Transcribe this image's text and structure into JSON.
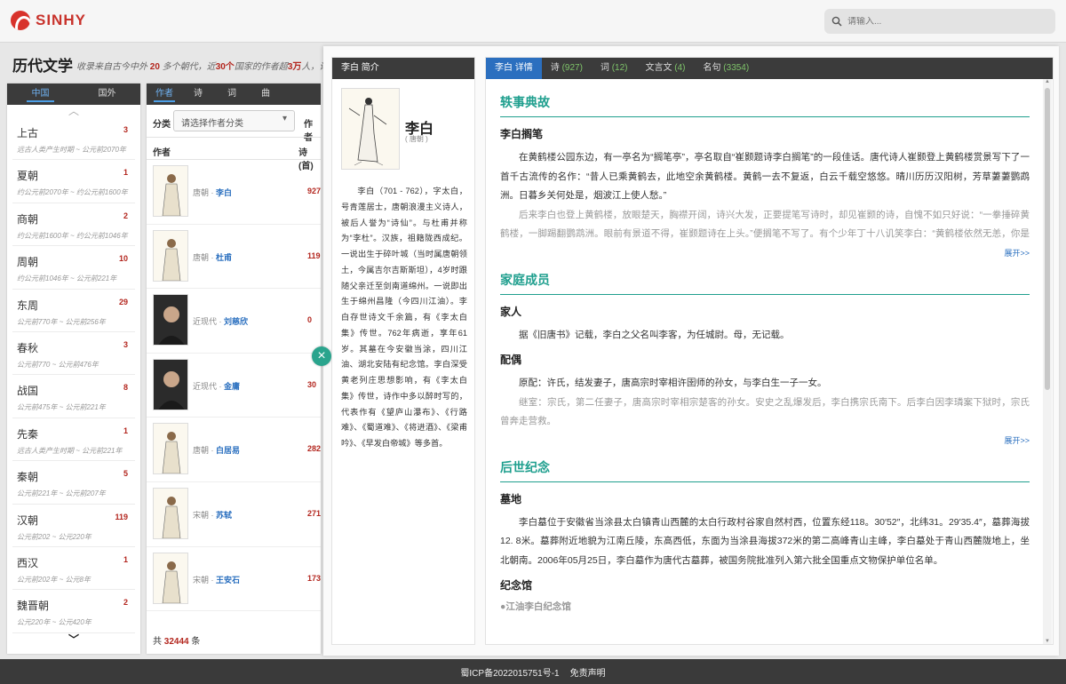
{
  "header": {
    "logo_text": "SINHY",
    "search_placeholder": "请输入..."
  },
  "page": {
    "title": "历代文学",
    "desc_prefix": "收录来自古今中外",
    "desc_n1": "20",
    "desc_mid1": "多个朝代，近",
    "desc_n2": "30个",
    "desc_mid2": "国家的作者超",
    "desc_n3": "3万",
    "desc_suffix": "人，诗、"
  },
  "dynasty_tabs": [
    "中国",
    "国外"
  ],
  "dynasties": [
    {
      "name": "上古",
      "count": "3",
      "range": "远古人类产生时期 ~ 公元前2070年"
    },
    {
      "name": "夏朝",
      "count": "1",
      "range": "约公元前2070年 ~ 约公元前1600年"
    },
    {
      "name": "商朝",
      "count": "2",
      "range": "约公元前1600年 ~ 约公元前1046年"
    },
    {
      "name": "周朝",
      "count": "10",
      "range": "约公元前1046年 ~ 公元前221年"
    },
    {
      "name": "东周",
      "count": "29",
      "range": "公元前770年 ~ 公元前256年"
    },
    {
      "name": "春秋",
      "count": "3",
      "range": "公元前770 ~ 公元前476年"
    },
    {
      "name": "战国",
      "count": "8",
      "range": "公元前475年 ~ 公元前221年"
    },
    {
      "name": "先秦",
      "count": "1",
      "range": "远古人类产生时期 ~ 公元前221年"
    },
    {
      "name": "秦朝",
      "count": "5",
      "range": "公元前221年 ~ 公元前207年"
    },
    {
      "name": "汉朝",
      "count": "119",
      "range": "公元前202 ~ 公元220年"
    },
    {
      "name": "西汉",
      "count": "1",
      "range": "公元前202年 ~ 公元8年"
    },
    {
      "name": "魏晋朝",
      "count": "2",
      "range": "公元220年 ~ 公元420年"
    }
  ],
  "author_tabs": [
    "作者",
    "诗",
    "词",
    "曲"
  ],
  "filter": {
    "label": "分类",
    "placeholder": "请选择作者分类",
    "label2": "作者"
  },
  "author_head": {
    "name": "作者",
    "poems": "诗(首)"
  },
  "authors": [
    {
      "dynasty": "唐朝 · ",
      "name": "李白",
      "count": "927",
      "photo": false
    },
    {
      "dynasty": "唐朝 · ",
      "name": "杜甫",
      "count": "119",
      "photo": false
    },
    {
      "dynasty": "近现代 · ",
      "name": "刘慈欣",
      "count": "0",
      "photo": true
    },
    {
      "dynasty": "近现代 · ",
      "name": "金庸",
      "count": "30",
      "photo": true
    },
    {
      "dynasty": "唐朝 · ",
      "name": "白居易",
      "count": "282",
      "photo": false
    },
    {
      "dynasty": "宋朝 · ",
      "name": "苏轼",
      "count": "271",
      "photo": false
    },
    {
      "dynasty": "宋朝 · ",
      "name": "王安石",
      "count": "173",
      "photo": false
    }
  ],
  "author_total": {
    "prefix": "共",
    "count": "32444",
    "suffix": "条"
  },
  "intro": {
    "header": "李白 简介",
    "name": "李白",
    "dynasty": "( 唐朝 )",
    "text": "李白（701 - 762），字太白，号青莲居士，唐朝浪漫主义诗人，被后人誉为“诗仙”。与杜甫并称为“李杜”。汉族，祖籍陇西成纪。一说出生于碎叶城（当时属唐朝领土，今属吉尔吉斯斯坦），4岁时跟随父亲迁至剑南道绵州。一说即出生于绵州昌隆（今四川江油）。李白存世诗文千余篇，有《李太白集》传世。762年病逝，享年61岁。其墓在今安徽当涂，四川江油、湖北安陆有纪念馆。李白深受黄老列庄思想影响，有《李太白集》传世，诗作中多以醉时写的，代表作有《望庐山瀑布》、《行路难》、《蜀道难》、《将进酒》、《梁甫吟》、《早发白帝城》等多首。"
  },
  "detail_tabs": [
    {
      "label": "李白 详情",
      "count": ""
    },
    {
      "label": "诗",
      "count": "(927)"
    },
    {
      "label": "词",
      "count": "(12)"
    },
    {
      "label": "文言文",
      "count": "(4)"
    },
    {
      "label": "名句",
      "count": "(3354)"
    }
  ],
  "detail": {
    "s1_title": "轶事典故",
    "s1_sub": "李白搁笔",
    "s1_p1": "在黄鹤楼公园东边，有一亭名为“搁笔亭”，亭名取自“崔颢题诗李白搁笔”的一段佳话。唐代诗人崔颢登上黄鹤楼赏景写下了一首千古流传的名作：“昔人已乘黄鹤去，此地空余黄鹤楼。黄鹤一去不复返，白云千载空悠悠。晴川历历汉阳树，芳草萋萋鹦鹉洲。日暮乡关何处是，烟波江上使人愁。”",
    "s1_p2": "后来李白也登上黄鹤楼，放眼楚天，胸襟开阔，诗兴大发，正要提笔写诗时，却见崔颢的诗，自愧不如只好说：“一拳捶碎黄鹤楼，一脚踢翻鹦鹉洲。眼前有景道不得，崔颢题诗在上头。”便搁笔不写了。有个少年丁十八讥笑李白：“黄鹤楼依然无恙，你是捶不碎了的。”李白又作诗辩解：“我确实捶碎了，只因黄鹤仙人上天哭诉玉帝，才又重修黄鹤楼，让黄鹤仙人重归楼上。”",
    "more": "展开>>",
    "s2_title": "家庭成员",
    "s2_sub1": "家人",
    "s2_p1": "据《旧唐书》记载，李白之父名叫李客，为任城尉。母，无记载。",
    "s2_sub2": "配偶",
    "s2_p2": "原配：许氏，结发妻子，唐高宗时宰相许圉师的孙女，与李白生一子一女。",
    "s2_p3": "继室：宗氏，第二任妻子，唐高宗时宰相宗楚客的孙女。安史之乱爆发后，李白携宗氏南下。后李白因李璘案下狱时，宗氏曾奔走营救。",
    "s3_title": "后世纪念",
    "s3_sub1": "墓地",
    "s3_p1": "李白墓位于安徽省当涂县太白镇青山西麓的太白行政村谷家自然村西，位置东经118。30′52″，北纬31。29′35.4″，墓葬海拔12. 8米。墓葬附近地貌为江南丘陵，东高西低，东面为当涂县海拔372米的第二高峰青山主峰，李白墓处于青山西麓陇地上，坐北朝南。2006年05月25日，李白墓作为唐代古墓葬，被国务院批准列入第六批全国重点文物保护单位名单。",
    "s3_sub2": "纪念馆",
    "s3_p2": "●江油李白纪念馆"
  },
  "footer": {
    "icp": "蜀ICP备2022015751号-1",
    "disclaimer": "免责声明"
  },
  "colors": {
    "accent": "#1f9f8e",
    "red": "#b3261e",
    "dark": "#3b3b3b",
    "blue": "#2a6fbf"
  }
}
